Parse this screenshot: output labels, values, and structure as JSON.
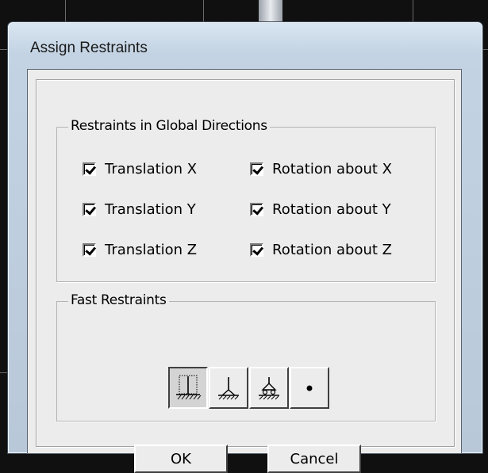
{
  "dialog": {
    "title": "Assign Restraints",
    "global_group": {
      "legend": "Restraints in Global Directions",
      "options": [
        {
          "label": "Translation X",
          "checked": true
        },
        {
          "label": "Rotation about X",
          "checked": true
        },
        {
          "label": "Translation Y",
          "checked": true
        },
        {
          "label": "Rotation about Y",
          "checked": true
        },
        {
          "label": "Translation Z",
          "checked": true
        },
        {
          "label": "Rotation about Z",
          "checked": true
        }
      ]
    },
    "fast_group": {
      "legend": "Fast Restraints",
      "buttons": [
        {
          "icon": "fixed-support-icon",
          "pressed": true
        },
        {
          "icon": "pinned-support-icon",
          "pressed": false
        },
        {
          "icon": "roller-support-icon",
          "pressed": false
        },
        {
          "icon": "free-node-icon",
          "pressed": false
        }
      ]
    },
    "ok_label": "OK",
    "cancel_label": "Cancel"
  }
}
